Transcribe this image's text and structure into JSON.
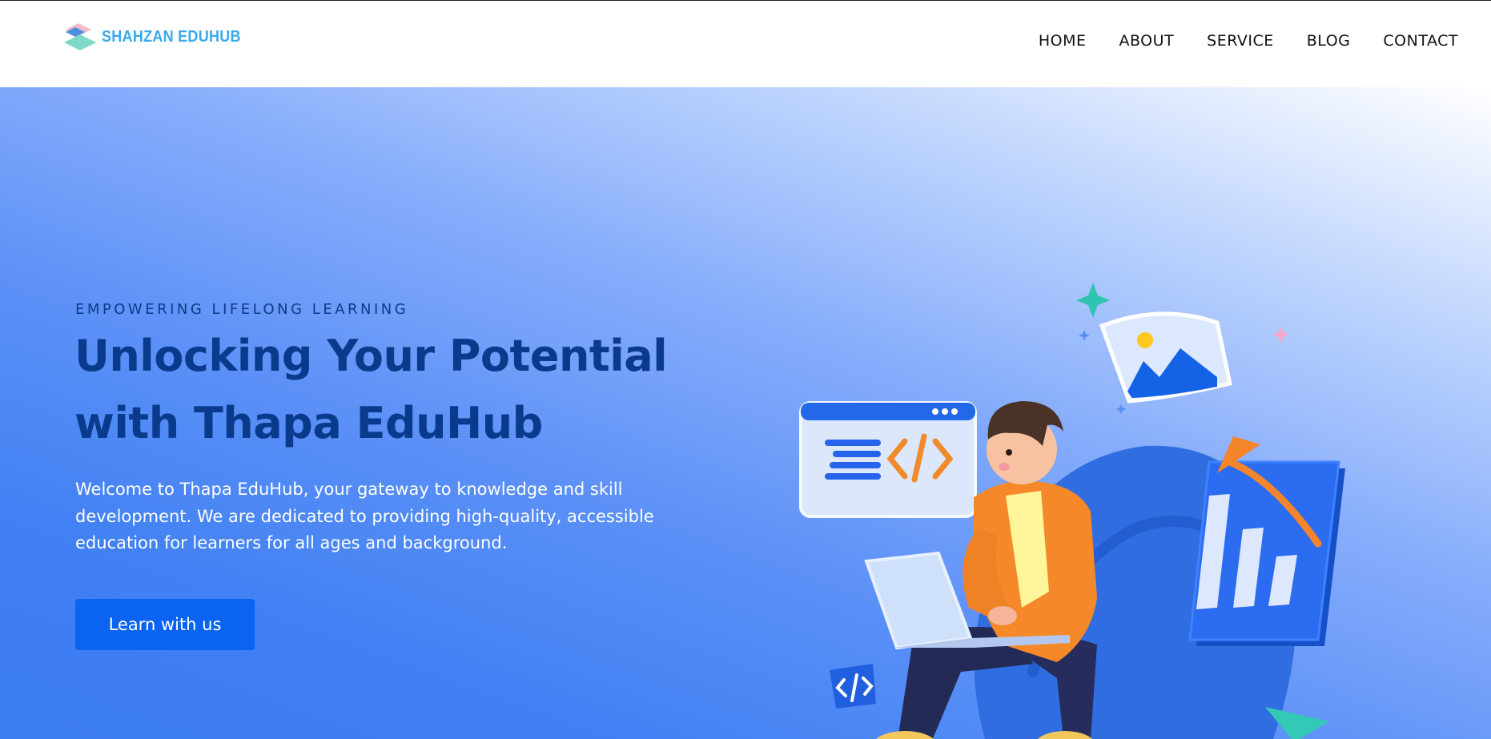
{
  "brand": {
    "name": "SHAHZAN EDUHUB",
    "color": "#3aa9ec"
  },
  "nav": {
    "items": [
      {
        "label": "HOME"
      },
      {
        "label": "ABOUT"
      },
      {
        "label": "SERVICE"
      },
      {
        "label": "BLOG"
      },
      {
        "label": "CONTACT"
      }
    ]
  },
  "hero": {
    "tagline": "EMPOWERING LIFELONG LEARNING",
    "headline": "Unlocking Your Potential with Thapa EduHub",
    "description": "Welcome to Thapa EduHub, your gateway to knowledge and skill development. We are dedicated to providing high-quality, accessible education for learners for all ages and background.",
    "cta_label": "Learn with us",
    "illustration_icon": "student-laptop-illustration"
  },
  "colors": {
    "accent": "#0b63f2",
    "headline": "#0a3a8c",
    "hero_gradient_light": "#ffffff",
    "hero_gradient_dark": "#3c7cf1"
  }
}
